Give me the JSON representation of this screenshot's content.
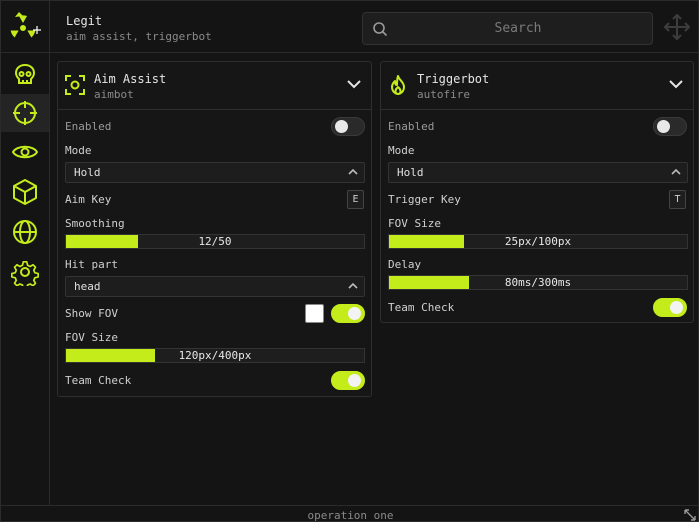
{
  "header": {
    "title": "Legit",
    "subtitle": "aim assist, triggerbot"
  },
  "search": {
    "placeholder": "Search"
  },
  "colors": {
    "accent": "#c3ec1a",
    "background": "#141414",
    "border": "#2b2b2b"
  },
  "sidebar": {
    "logo_icon": "radiation-icon",
    "items": [
      {
        "icon": "skull-icon",
        "active": false
      },
      {
        "icon": "crosshair-icon",
        "active": true
      },
      {
        "icon": "eye-icon",
        "active": false
      },
      {
        "icon": "cube-icon",
        "active": false
      },
      {
        "icon": "globe-icon",
        "active": false
      },
      {
        "icon": "gear-icon",
        "active": false
      }
    ]
  },
  "aim": {
    "title": "Aim Assist",
    "subtitle": "aimbot",
    "enabled_label": "Enabled",
    "enabled": false,
    "mode_label": "Mode",
    "mode_value": "Hold",
    "aim_key_label": "Aim Key",
    "aim_key": "E",
    "smoothing_label": "Smoothing",
    "smoothing_text": "12/50",
    "smoothing_fraction": 0.24,
    "hit_part_label": "Hit part",
    "hit_part_value": "head",
    "show_fov_label": "Show FOV",
    "show_fov": true,
    "fov_color": "#ffffff",
    "fov_size_label": "FOV Size",
    "fov_size_text": "120px/400px",
    "fov_size_fraction": 0.3,
    "team_check_label": "Team Check",
    "team_check": true
  },
  "trigger": {
    "title": "Triggerbot",
    "subtitle": "autofire",
    "enabled_label": "Enabled",
    "enabled": false,
    "mode_label": "Mode",
    "mode_value": "Hold",
    "trigger_key_label": "Trigger Key",
    "trigger_key": "T",
    "fov_size_label": "FOV Size",
    "fov_size_text": "25px/100px",
    "fov_size_fraction": 0.25,
    "delay_label": "Delay",
    "delay_text": "80ms/300ms",
    "delay_fraction": 0.267,
    "team_check_label": "Team Check",
    "team_check": true
  },
  "footer": {
    "text": "operation one"
  }
}
